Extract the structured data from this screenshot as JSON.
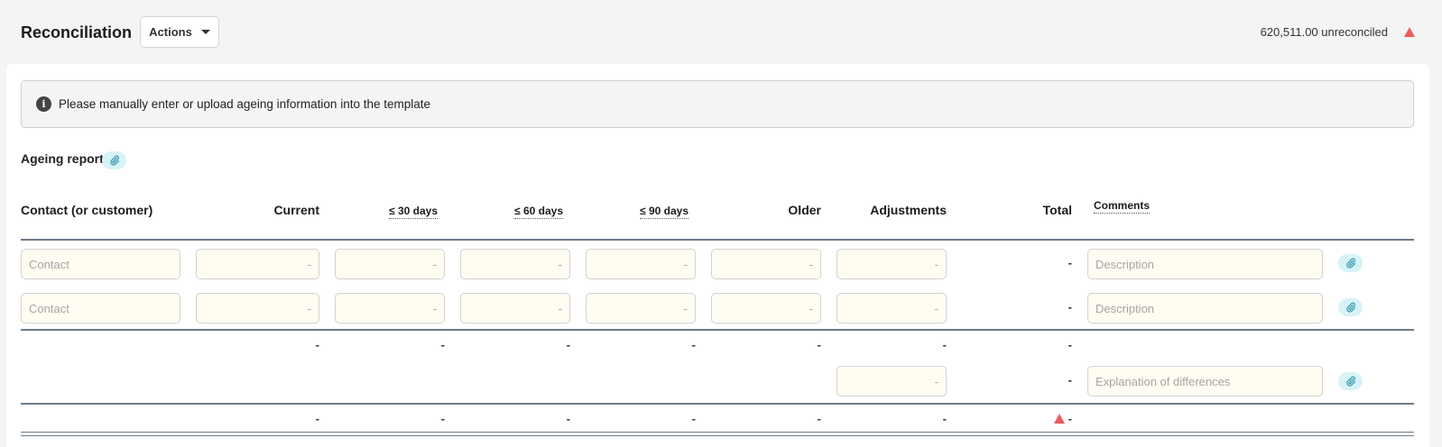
{
  "header": {
    "title": "Reconciliation",
    "actions_label": "Actions",
    "unreconciled_text": "620,511.00 unreconciled",
    "warn_color": "#ef5b5b"
  },
  "info": {
    "icon": "info-icon",
    "message": "Please manually enter or upload ageing information into the template"
  },
  "section": {
    "title": "Ageing report",
    "attach_icon": "paperclip-icon"
  },
  "columns": {
    "contact": "Contact (or customer)",
    "current": "Current",
    "d30": "≤ 30 days",
    "d60": "≤ 60 days",
    "d90": "≤ 90 days",
    "older": "Older",
    "adjustments": "Adjustments",
    "total": "Total",
    "comments": "Comments"
  },
  "rows": [
    {
      "contact_placeholder": "Contact",
      "current": "-",
      "d30": "-",
      "d60": "-",
      "d90": "-",
      "older": "-",
      "adjustments": "-",
      "total": "-",
      "comment_placeholder": "Description"
    },
    {
      "contact_placeholder": "Contact",
      "current": "-",
      "d30": "-",
      "d60": "-",
      "d90": "-",
      "older": "-",
      "adjustments": "-",
      "total": "-",
      "comment_placeholder": "Description"
    }
  ],
  "subtotal": {
    "current": "-",
    "d30": "-",
    "d60": "-",
    "d90": "-",
    "older": "-",
    "adjustments": "-",
    "total": "-"
  },
  "difference": {
    "adjustments": "-",
    "total": "-",
    "comment_placeholder": "Explanation of differences"
  },
  "grand_total": {
    "current": "-",
    "d30": "-",
    "d60": "-",
    "d90": "-",
    "older": "-",
    "adjustments": "-",
    "total": "-"
  }
}
